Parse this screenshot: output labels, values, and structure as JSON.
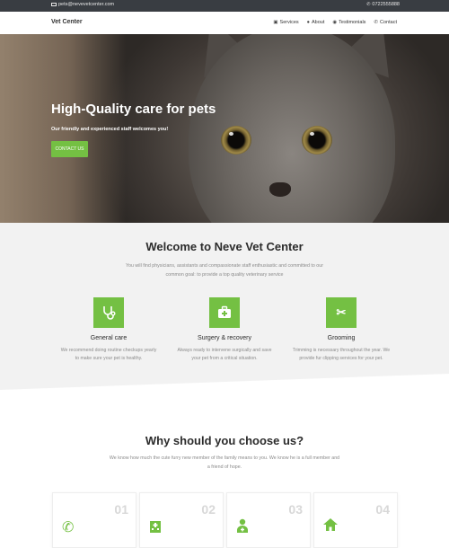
{
  "topbar": {
    "email": "pets@nevevetcenter.com",
    "phone": "0722555888"
  },
  "header": {
    "brand": "Vet Center",
    "nav": [
      {
        "label": "Services",
        "icon": "services-icon"
      },
      {
        "label": "About",
        "icon": "user-icon"
      },
      {
        "label": "Testimonials",
        "icon": "users-icon"
      },
      {
        "label": "Contact",
        "icon": "phone-icon"
      }
    ]
  },
  "hero": {
    "title": "High-Quality care for pets",
    "subtitle": "Our friendly and experienced staff welcomes you!",
    "button": "CONTACT US"
  },
  "welcome": {
    "title": "Welcome to Neve Vet Center",
    "text": "You will find physicians, assistants and compassionate staff enthusiastic and committed to our common goal: to provide a top quality veterinary service",
    "features": [
      {
        "icon": "stethoscope-icon",
        "title": "General care",
        "text": "We recommend doing routine checkups yearly to make sure your pet is healthy."
      },
      {
        "icon": "medkit-icon",
        "title": "Surgery & recovery",
        "text": "Always ready to intervene surgically and save your pet from a critical situation."
      },
      {
        "icon": "scissors-icon",
        "title": "Grooming",
        "text": "Trimming is necessary throughout the year. We provide fur clipping services for your pet."
      }
    ],
    "accent_color": "#74c043"
  },
  "why": {
    "title": "Why should you choose us?",
    "text": "We know how much the cute furry new member of the family means to you. We know he is a full member and a friend of hope.",
    "cards": [
      {
        "number": "01",
        "icon": "phone-volume-icon"
      },
      {
        "number": "02",
        "icon": "hospital-icon"
      },
      {
        "number": "03",
        "icon": "doctor-icon"
      },
      {
        "number": "04",
        "icon": "home-icon"
      }
    ]
  }
}
